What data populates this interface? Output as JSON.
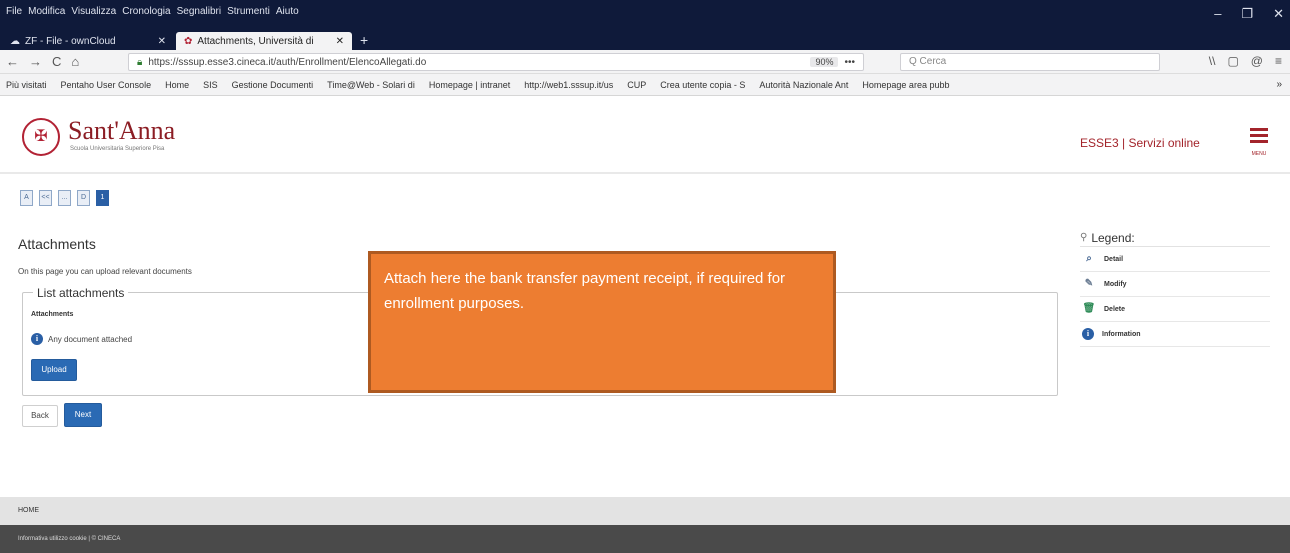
{
  "browser": {
    "menu": [
      "File",
      "Modifica",
      "Visualizza",
      "Cronologia",
      "Segnalibri",
      "Strumenti",
      "Aiuto"
    ],
    "window_controls": [
      "–",
      "❐",
      "✕"
    ],
    "tabs": [
      {
        "label": "ZF - File - ownCloud",
        "close": "✕"
      },
      {
        "label": "Attachments, Università di",
        "close": "✕"
      }
    ],
    "new_tab": "+",
    "nav": {
      "back": "←",
      "forward": "→",
      "reload": "C",
      "home": "⌂"
    },
    "url": "https://sssup.esse3.cineca.it/auth/Enrollment/ElencoAllegati.do",
    "zoom": "90%",
    "url_more": "•••",
    "search_placeholder": "Q Cerca",
    "toolbar_icons": [
      "\\\\",
      "▢",
      "@",
      "≡"
    ],
    "bookmarks": [
      "Più visitati",
      "Pentaho User Console",
      "Home",
      "SIS",
      "Gestione Documenti",
      "Time@Web - Solari di",
      "Homepage | intranet",
      "http://web1.sssup.it/us",
      "CUP",
      "Crea utente copia - S",
      "Autorità Nazionale Ant",
      "Homepage area pubb"
    ],
    "bookmarks_more": "»"
  },
  "header": {
    "logo_name": "Sant'Anna",
    "logo_subtitle": "Scuola Universitaria Superiore Pisa",
    "services": "ESSE3 | Servizi online",
    "menu_label": "MENU"
  },
  "steps": [
    "A",
    "<<",
    "...",
    "D",
    "1"
  ],
  "main": {
    "title": "Attachments",
    "intro": "On this page you can upload relevant documents",
    "list_title": "List attachments",
    "attachments_heading": "Attachments",
    "empty_message": "Any document attached",
    "upload_label": "Upload",
    "back_label": "Back",
    "next_label": "Next"
  },
  "legend": {
    "title": "Legend:",
    "items": [
      {
        "label": "Detail",
        "icon": "magnifier-icon"
      },
      {
        "label": "Modify",
        "icon": "pencil-icon"
      },
      {
        "label": "Delete",
        "icon": "trash-icon"
      },
      {
        "label": "Information",
        "icon": "info-icon"
      }
    ]
  },
  "callout": {
    "text": "Attach here the bank transfer payment receipt, if required for enrollment purposes.",
    "color": "#ed7d31"
  },
  "footer": {
    "home": "HOME",
    "bottom": "Informativa utilizzo cookie | © CINECA"
  },
  "colors": {
    "brand": "#8c1d24",
    "primary_button": "#2a6ab4",
    "chrome": "#0f1a3a"
  }
}
